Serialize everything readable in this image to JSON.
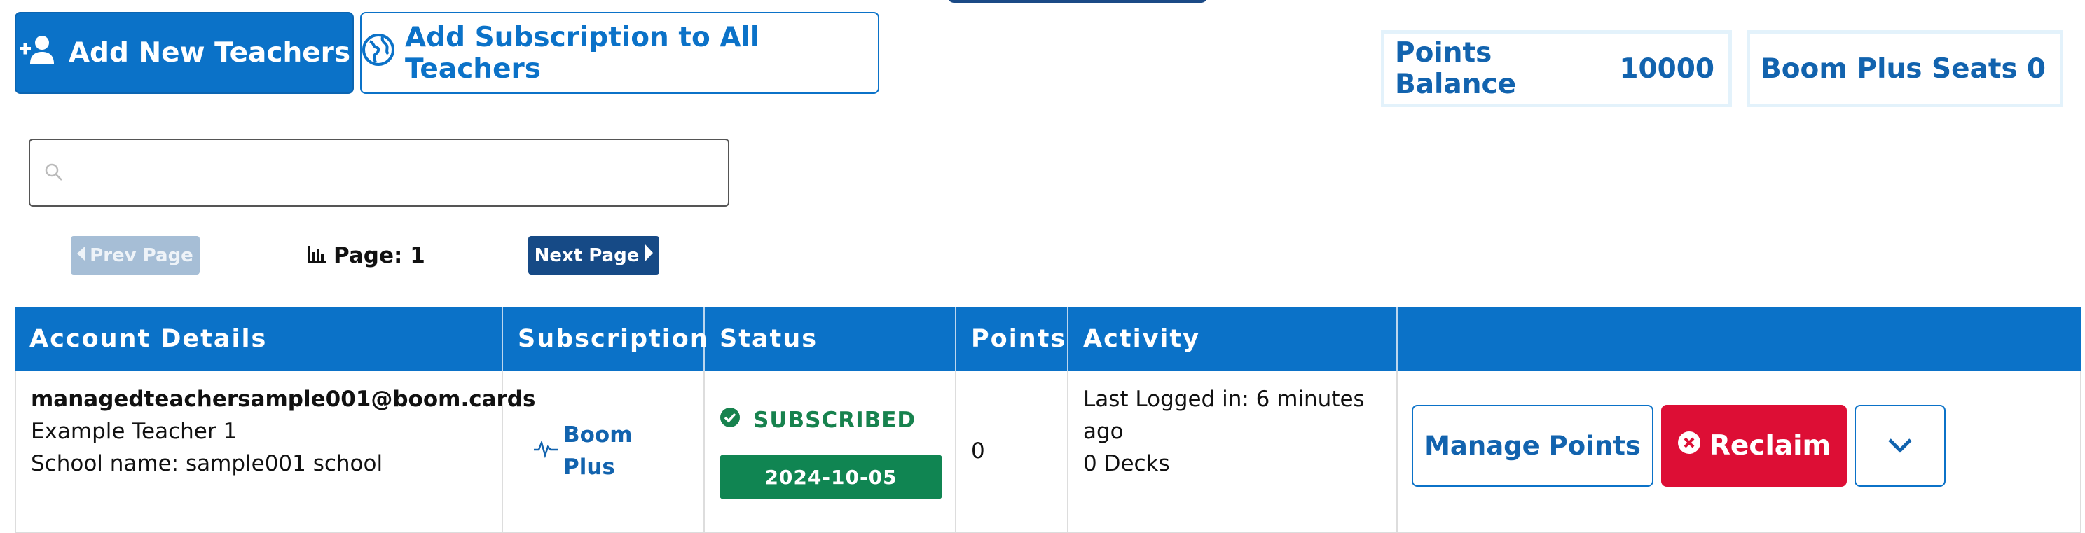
{
  "toolbar": {
    "add_teachers_label": "Add New Teachers",
    "add_subscription_label": "Add Subscription to All Teachers"
  },
  "stats": {
    "points_balance_label": "Points Balance",
    "points_balance_value": "10000",
    "boom_plus_seats_label": "Boom Plus Seats",
    "boom_plus_seats_value": "0"
  },
  "search": {
    "placeholder": "",
    "value": ""
  },
  "pager": {
    "prev_label": "Prev Page",
    "page_label": "Page: 1",
    "next_label": "Next Page"
  },
  "table": {
    "headers": [
      "Account Details",
      "Subscription",
      "Status",
      "Points",
      "Activity",
      ""
    ],
    "rows": [
      {
        "email": "managedteachersample001@boom.cards",
        "name": "Example Teacher 1",
        "school": "School name: sample001 school",
        "subscription": "Boom Plus",
        "status": "SUBSCRIBED",
        "date": "2024-10-05",
        "points": "0",
        "last_login": "Last Logged in: 6 minutes ago",
        "decks": "0 Decks",
        "manage_label": "Manage Points",
        "reclaim_label": "Reclaim"
      }
    ]
  },
  "colors": {
    "primary": "#0b72c8",
    "dark_blue": "#164a86",
    "danger": "#dd0e35",
    "success": "#108552"
  }
}
